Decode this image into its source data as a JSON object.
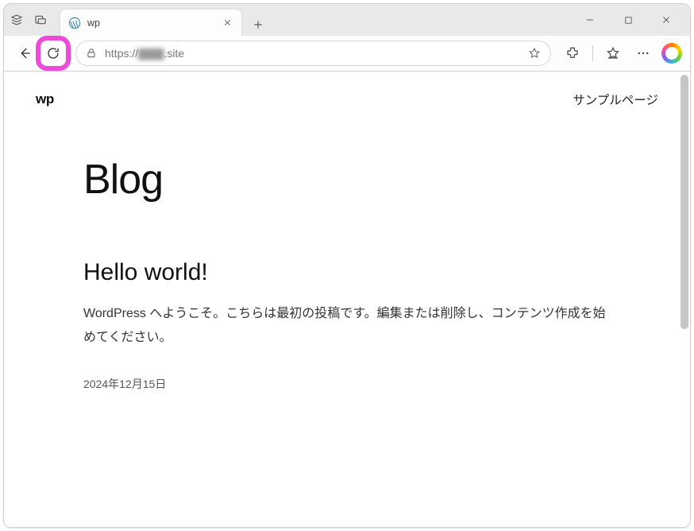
{
  "browser": {
    "tab": {
      "title": "wp"
    },
    "url": {
      "protocol": "https://",
      "host_blurred": "▇▇▇",
      "suffix": ".site"
    }
  },
  "site": {
    "name": "wp",
    "nav": {
      "sample_page": "サンプルページ"
    }
  },
  "page": {
    "heading": "Blog",
    "post": {
      "title": "Hello world!",
      "excerpt": "WordPress へようこそ。こちらは最初の投稿です。編集または削除し、コンテンツ作成を始めてください。",
      "date": "2024年12月15日"
    }
  }
}
